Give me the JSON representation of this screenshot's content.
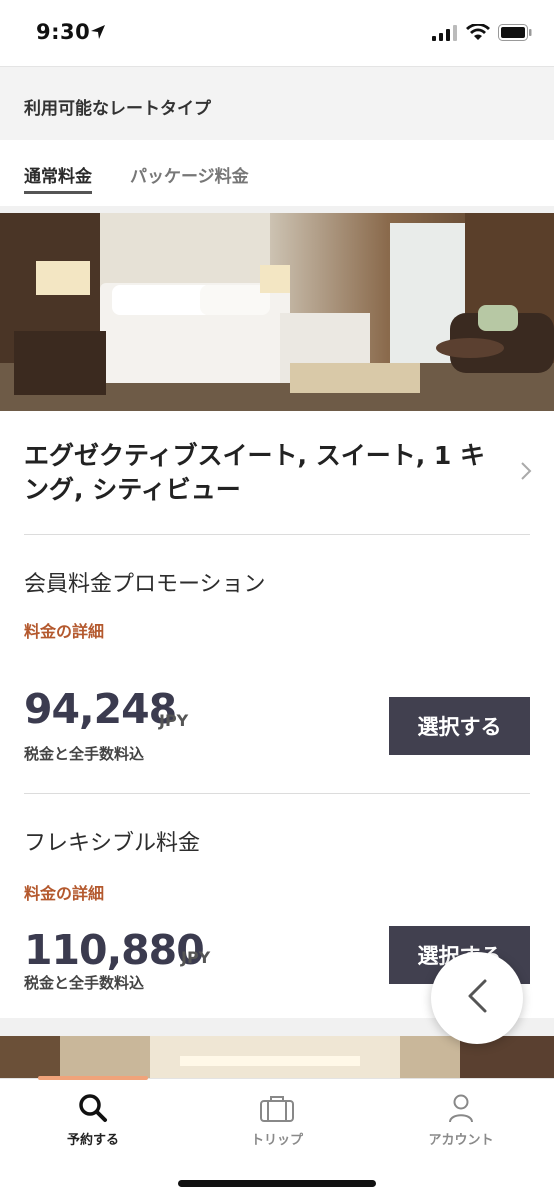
{
  "status": {
    "time": "9:30"
  },
  "header": {
    "title": "利用可能なレートタイプ"
  },
  "tabs": [
    {
      "label": "通常料金",
      "active": true
    },
    {
      "label": "パッケージ料金",
      "active": false
    }
  ],
  "room": {
    "title": "エグゼクティブスイート, スイート, 1 キング, シティビュー",
    "image_icon": "hotel-room-photo"
  },
  "rates": [
    {
      "name": "会員料金プロモーション",
      "details_link": "料金の詳細",
      "price": "94,248",
      "currency": "JPY",
      "tax_note": "税金と全手数料込",
      "button": "選択する"
    },
    {
      "name": "フレキシブル料金",
      "details_link": "料金の詳細",
      "price": "110,880",
      "currency": "JPY",
      "tax_note": "税金と全手数料込",
      "button": "選択する"
    }
  ],
  "tab_bar": [
    {
      "label": "予約する",
      "icon": "search-icon",
      "active": true
    },
    {
      "label": "トリップ",
      "icon": "suitcase-icon",
      "active": false
    },
    {
      "label": "アカウント",
      "icon": "person-icon",
      "active": false
    }
  ],
  "colors": {
    "accent": "#b4592e",
    "button": "#41404f",
    "price": "#3b3b4f",
    "tab_indicator": "#f0a37a"
  }
}
